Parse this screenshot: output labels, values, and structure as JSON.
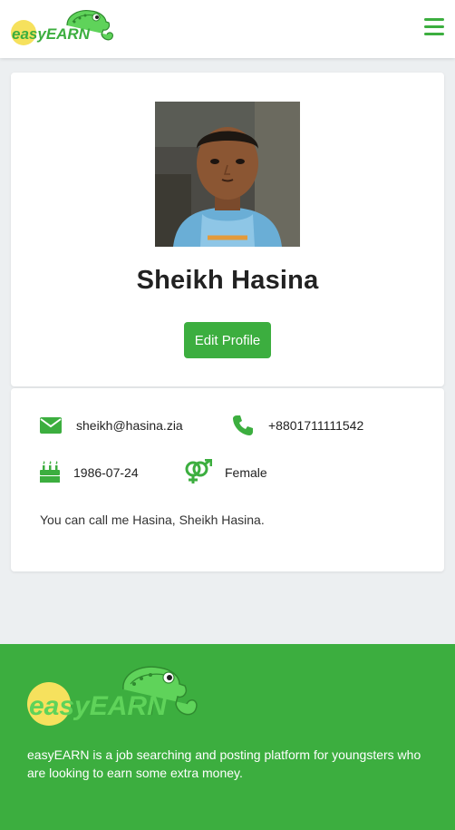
{
  "header": {
    "logo_text": "easyEARN",
    "menu_icon": "hamburger-menu-icon"
  },
  "profile": {
    "name": "Sheikh Hasina",
    "edit_button_label": "Edit Profile",
    "email": "sheikh@hasina.zia",
    "phone": "+8801711111542",
    "birthdate": "1986-07-24",
    "gender": "Female",
    "bio": "You can call me Hasina, Sheikh Hasina."
  },
  "icons": {
    "email": "envelope-icon",
    "phone": "phone-icon",
    "birthdate": "birthday-cake-icon",
    "gender": "venus-mars-icon"
  },
  "footer": {
    "logo_text": "easyEARN",
    "description": "easyEARN is a job searching and posting platform for youngsters who are looking to earn some extra money."
  },
  "colors": {
    "brand_green": "#3cae3f",
    "logo_yellow": "#f6e15d",
    "chameleon_green": "#5fd35a"
  }
}
